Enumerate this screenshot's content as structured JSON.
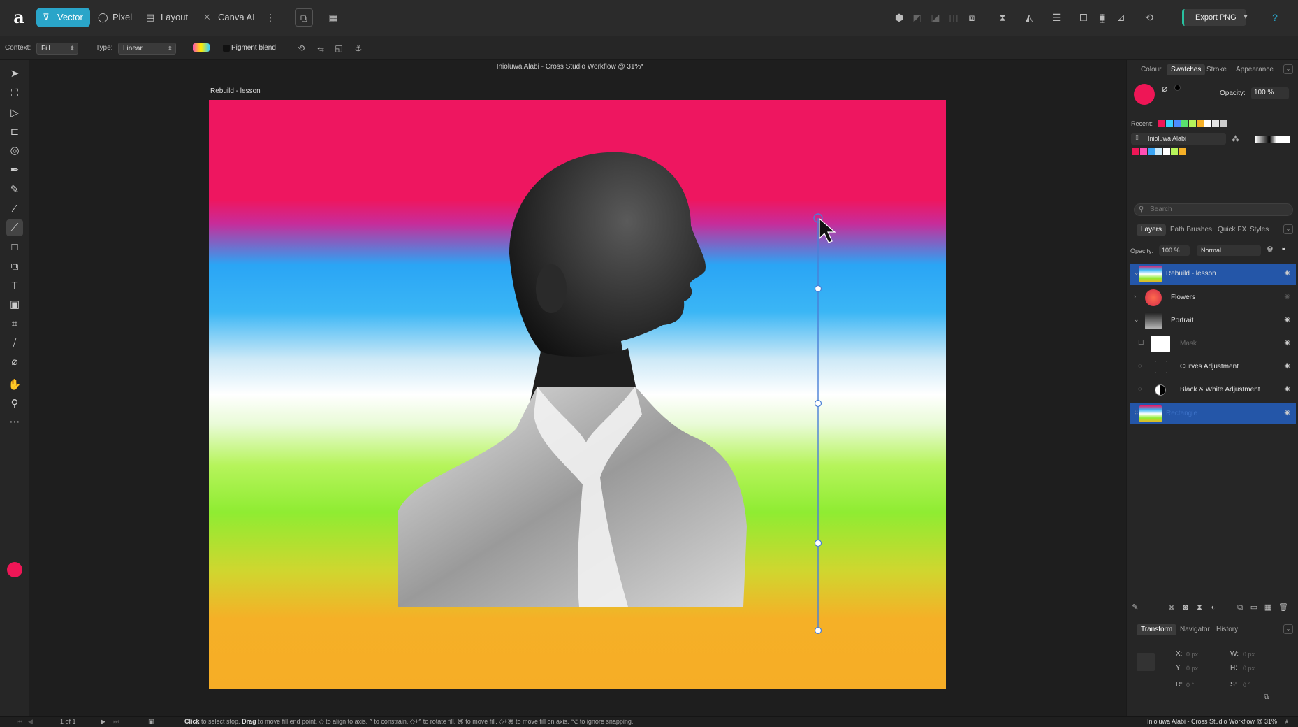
{
  "app": {
    "personas": [
      {
        "label": "Vector",
        "icon": "vector-persona-icon"
      },
      {
        "label": "Pixel",
        "icon": "pixel-persona-icon"
      },
      {
        "label": "Layout",
        "icon": "layout-persona-icon"
      },
      {
        "label": "Canva AI",
        "icon": "canva-ai-icon"
      }
    ],
    "export_label": "Export PNG"
  },
  "context_bar": {
    "context_label": "Context:",
    "context_value": "Fill",
    "type_label": "Type:",
    "type_value": "Linear",
    "pigment_label": "Pigment blend"
  },
  "document": {
    "title": "Inioluwa Alabi - Cross Studio Workflow @ 31%*",
    "artboard_label": "Rebuild - lesson"
  },
  "fill_color": "#ee1656",
  "colour_panel": {
    "tabs": [
      "Colour",
      "Swatches",
      "Stroke",
      "Appearance"
    ],
    "active_tab": "Swatches",
    "opacity_label": "Opacity:",
    "opacity_value": "100 %",
    "recent_label": "Recent:",
    "palette_name": "Inioluwa Alabi",
    "search_placeholder": "Search",
    "recent_colors": [
      "#ee1656",
      "#3ad1ff",
      "#4c8cff",
      "#59e06e",
      "#b6f45b",
      "#f5b027",
      "#ffffff",
      "#e5e5e5",
      "#cccccc"
    ],
    "palette_colors": [
      "#ee1656",
      "#ff4fb3",
      "#3aa5f5",
      "#cde9f7",
      "#ffffff",
      "#b6f45b",
      "#f5b027"
    ]
  },
  "layers_panel": {
    "tabs": [
      "Layers",
      "Path Brushes",
      "Quick FX",
      "Styles"
    ],
    "active_tab": "Layers",
    "opacity_label": "Opacity:",
    "opacity_value": "100 %",
    "blend_mode": "Normal",
    "layers": [
      {
        "name": "Rebuild - lesson",
        "selected": true
      },
      {
        "name": "Flowers",
        "selected": false
      },
      {
        "name": "Portrait",
        "selected": false
      },
      {
        "name": "Mask",
        "selected": false
      },
      {
        "name": "Curves Adjustment",
        "selected": false
      },
      {
        "name": "Black & White Adjustment",
        "selected": false
      },
      {
        "name": "Rectangle",
        "selected": true
      }
    ]
  },
  "transform_panel": {
    "tabs": [
      "Transform",
      "Navigator",
      "History"
    ],
    "active_tab": "Transform",
    "x_label": "X:",
    "x_value": "0 px",
    "y_label": "Y:",
    "y_value": "0 px",
    "w_label": "W:",
    "w_value": "0 px",
    "h_label": "H:",
    "h_value": "0 px",
    "r_label": "R:",
    "r_value": "0 °",
    "s_label": "S:",
    "s_value": "0 °"
  },
  "status_bar": {
    "page": "1 of 1",
    "hint_click": "Click",
    "hint_click_text": "to select stop.",
    "hint_drag": "Drag",
    "hint_drag_text": "to move fill end point. ◇ to align to axis. ^ to constrain. ◇+^ to rotate fill. ⌘ to move fill. ◇+⌘ to move fill on axis. ⌥ to ignore snapping.",
    "document_name": "Inioluwa Alabi - Cross Studio Workflow @ 31%"
  }
}
